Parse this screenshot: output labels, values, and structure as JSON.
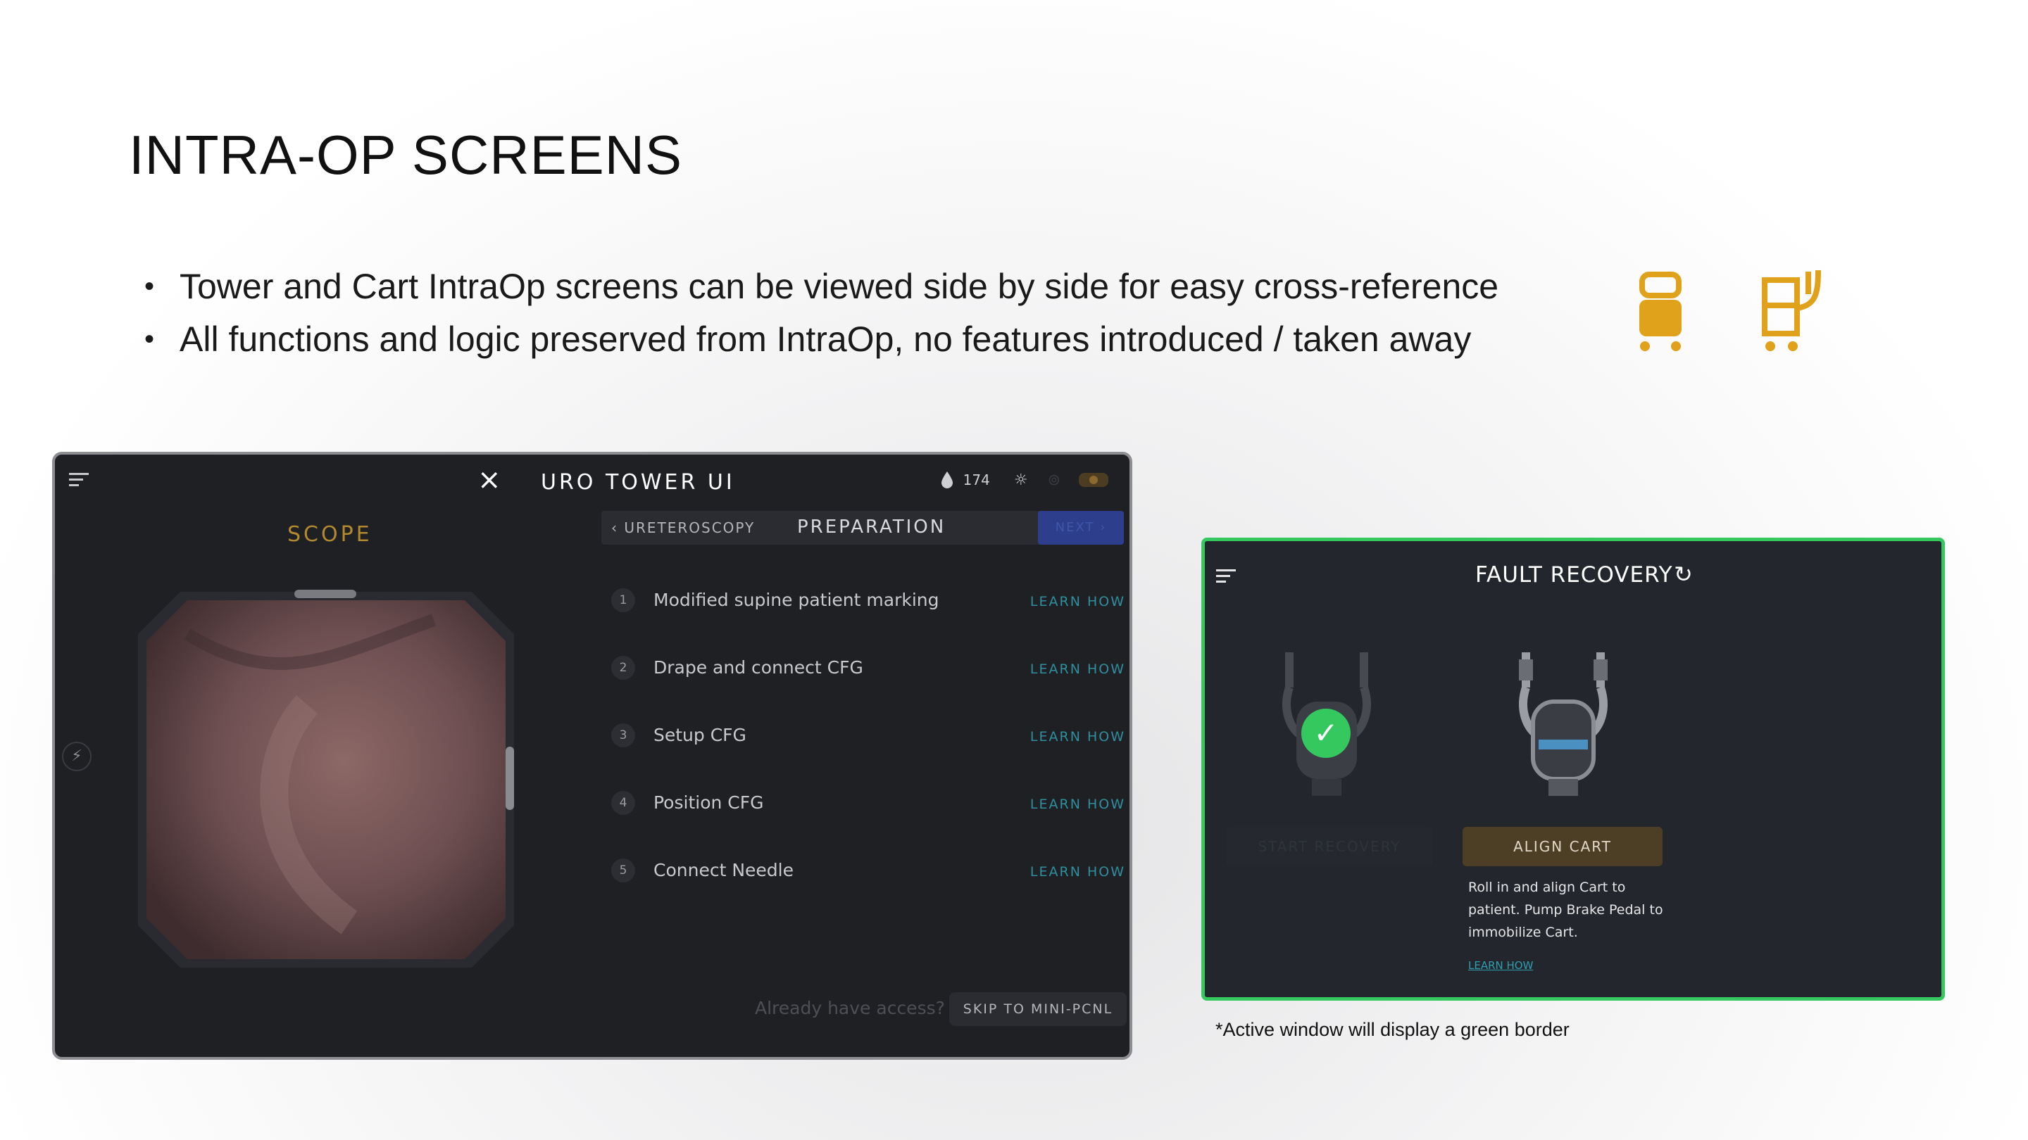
{
  "page": {
    "title": "INTRA-OP SCREENS",
    "bullets": [
      "Tower and Cart IntraOp screens can be viewed side by side for easy cross-reference",
      "All functions and logic preserved from IntraOp, no features introduced / taken away"
    ],
    "icons": [
      "tower-icon",
      "cart-icon"
    ],
    "accent_color": "#e0a21b",
    "note": "*Active window will display a green border"
  },
  "tower": {
    "close_icon": "×",
    "title": "URO TOWER UI",
    "fluid_value": "174",
    "scope_label": "SCOPE",
    "nav": {
      "back_label": "URETEROSCOPY",
      "current": "PREPARATION",
      "next_label": "NEXT"
    },
    "steps": [
      {
        "num": "1",
        "label": "Modified supine patient marking",
        "action": "LEARN HOW"
      },
      {
        "num": "2",
        "label": "Drape and connect CFG",
        "action": "LEARN HOW"
      },
      {
        "num": "3",
        "label": "Setup CFG",
        "action": "LEARN HOW"
      },
      {
        "num": "4",
        "label": "Position CFG",
        "action": "LEARN HOW"
      },
      {
        "num": "5",
        "label": "Connect Needle",
        "action": "LEARN HOW"
      }
    ],
    "access_text": "Already have access?",
    "skip_label": "SKIP TO MINI-PCNL",
    "scope_color": "#b2892e",
    "link_color": "#2f8f9e"
  },
  "cart": {
    "title": "FAULT RECOVERY",
    "start_label": "START RECOVERY",
    "align_label": "ALIGN CART",
    "align_desc": "Roll in and align Cart to patient. Pump Brake Pedal to immobilize Cart.",
    "learn_label": "LEARN HOW",
    "border_color": "#35c85f"
  }
}
